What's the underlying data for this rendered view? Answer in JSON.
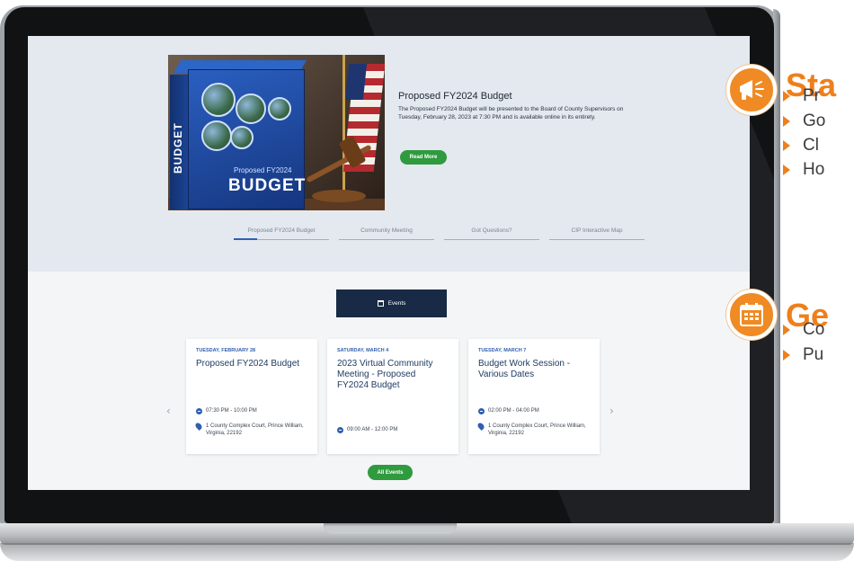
{
  "hero": {
    "title": "Proposed FY2024 Budget",
    "description": "The Proposed FY2024 Budget will be presented to the Board of County Supervisors on Tuesday, February 28, 2023 at 7:30 PM and is available online in its entirety.",
    "read_more": "Read More",
    "image_box_subtitle": "Proposed FY2024",
    "image_box_title": "BUDGET",
    "image_box_spine": "BUDGET"
  },
  "tabs": [
    {
      "label": "Proposed FY2024 Budget",
      "active": true
    },
    {
      "label": "Community Meeting",
      "active": false
    },
    {
      "label": "Got Questions?",
      "active": false
    },
    {
      "label": "CIP Interactive Map",
      "active": false
    }
  ],
  "events": {
    "button_label": "Events",
    "all_events_label": "All Events",
    "prev_arrow": "‹",
    "next_arrow": "›",
    "cards": [
      {
        "date": "TUESDAY, FEBRUARY 28",
        "title": "Proposed FY2024 Budget",
        "time": "07:30 PM - 10:00 PM",
        "location": "1 County Complex Court, Prince William, Virginia, 22192"
      },
      {
        "date": "SATURDAY, MARCH 4",
        "title": "2023 Virtual Community Meeting - Proposed FY2024 Budget",
        "time": "09:00 AM - 12:00 PM",
        "location": ""
      },
      {
        "date": "TUESDAY, MARCH 7",
        "title": "Budget Work Session - Various Dates",
        "time": "02:00 PM - 04:00 PM",
        "location": "1 County Complex Court, Prince William, Virginia, 22192"
      }
    ]
  },
  "side_panels": {
    "panel1": {
      "title": "Sta",
      "icon": "megaphone-icon",
      "items": [
        "Pr",
        "Go",
        "Cl",
        "Ho"
      ]
    },
    "panel2": {
      "title": "Ge",
      "icon": "calendar-icon",
      "items": [
        "Co",
        "Pu"
      ]
    }
  },
  "colors": {
    "accent_orange": "#ef7f1a",
    "accent_green": "#2f9a3e",
    "navy": "#182a45",
    "link_blue": "#2f5fb0"
  }
}
